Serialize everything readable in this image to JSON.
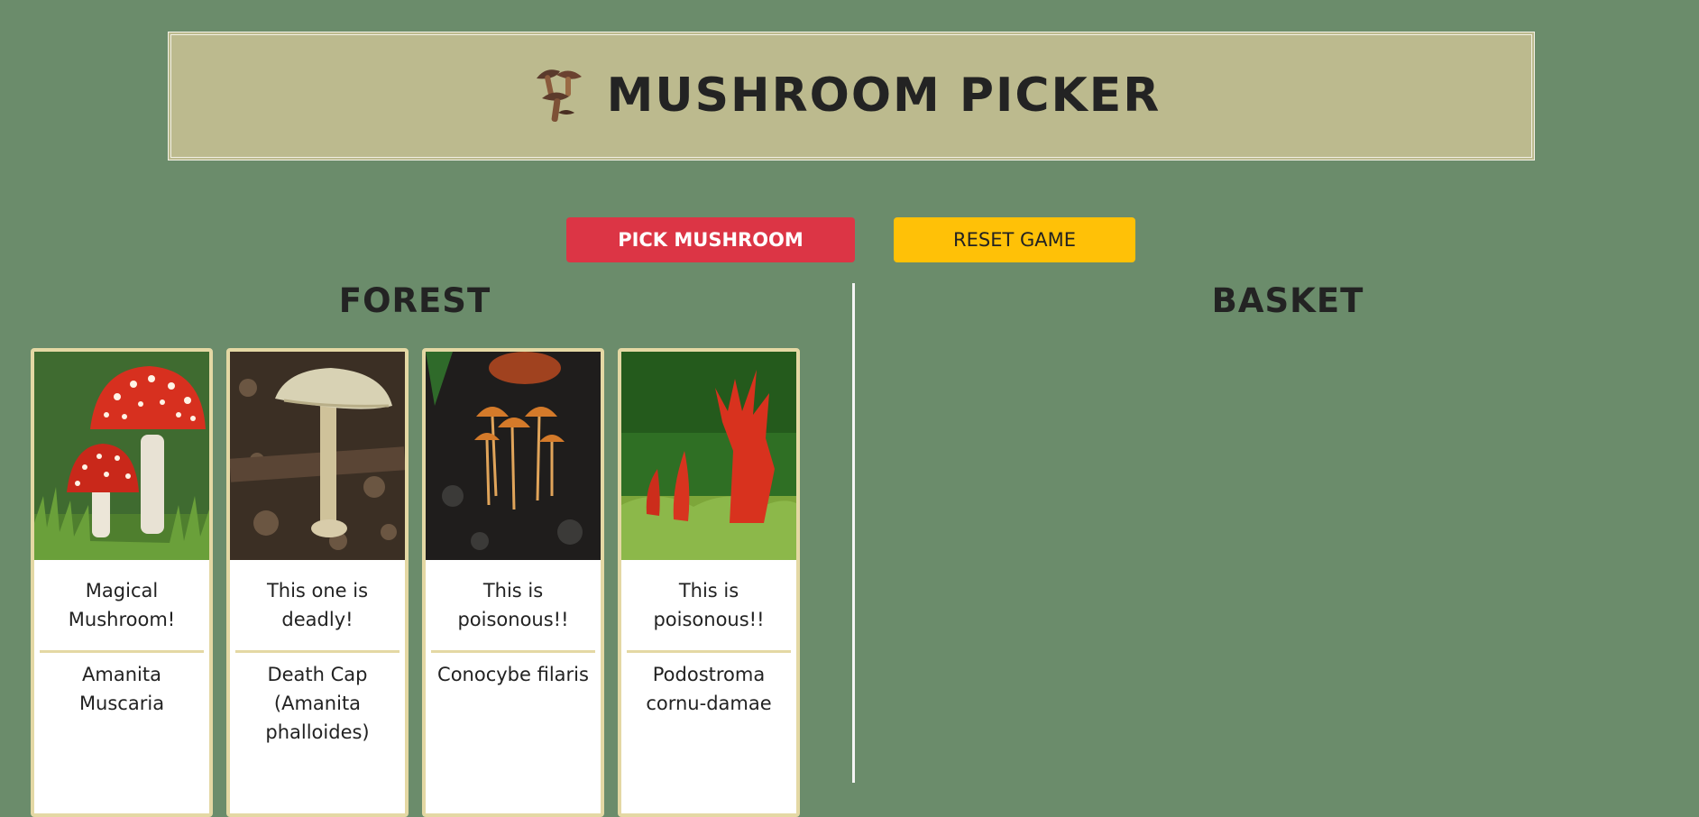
{
  "header": {
    "logo_icon": "mushroom-cluster-icon",
    "title": "MUSHROOM PICKER"
  },
  "controls": {
    "pick_label": "PICK MUSHROOM",
    "reset_label": "RESET GAME"
  },
  "forest": {
    "title": "FOREST",
    "cards": [
      {
        "description": "Magical Mushroom!",
        "name": "Amanita Muscaria",
        "image": "fly-agaric-photo"
      },
      {
        "description": "This one is deadly!",
        "name": "Death Cap (Amanita phalloides)",
        "image": "death-cap-photo"
      },
      {
        "description": "This is poisonous!!",
        "name": "Conocybe filaris",
        "image": "conocybe-photo"
      },
      {
        "description": "This is poisonous!!",
        "name": "Podostroma cornu-damae",
        "image": "poison-fire-coral-photo"
      }
    ]
  },
  "basket": {
    "title": "BASKET",
    "items": []
  },
  "colors": {
    "background": "#6b8c6b",
    "header": "#bcba8e",
    "pick": "#dc3545",
    "reset": "#ffc107",
    "card_border": "#e4d8a4"
  }
}
